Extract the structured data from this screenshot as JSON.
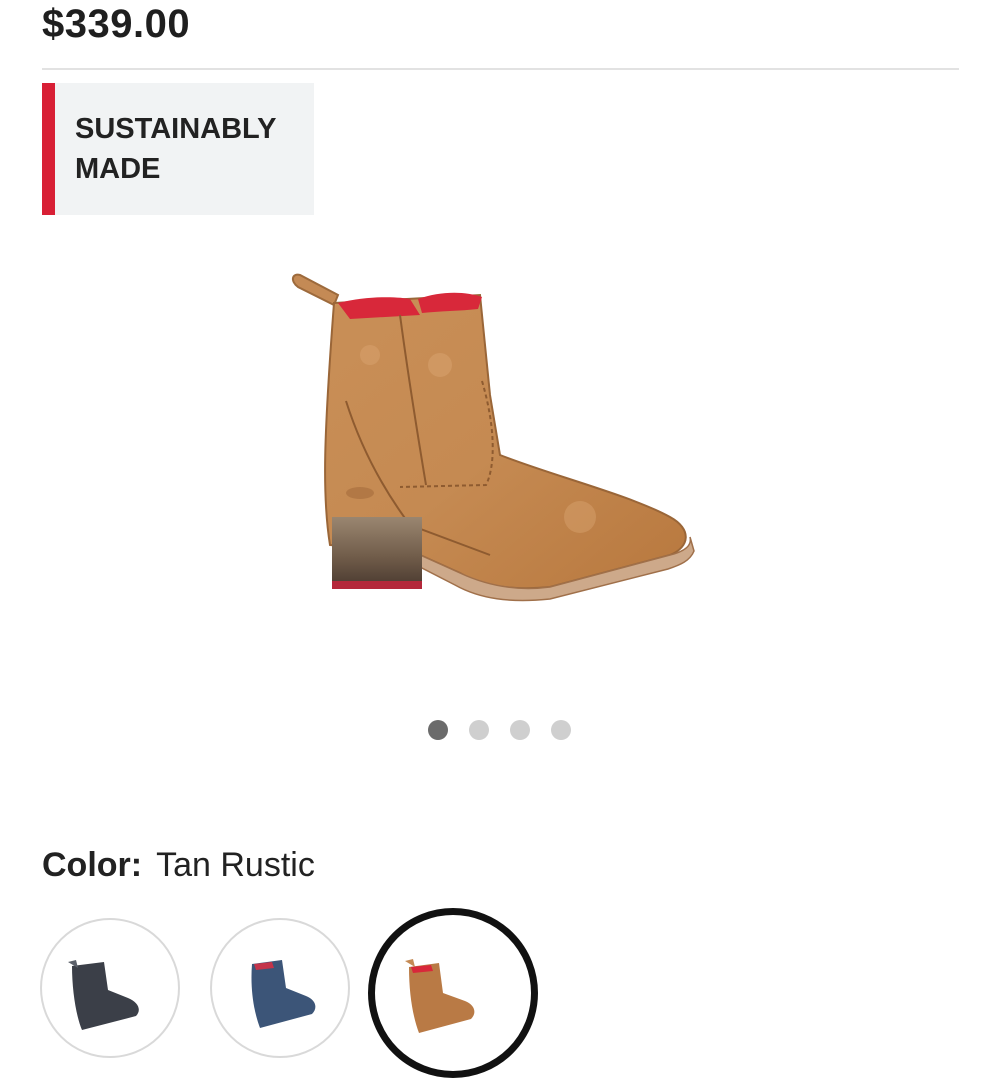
{
  "product": {
    "price": "$339.00",
    "badge_line1": "SUSTAINABLY",
    "badge_line2": "MADE",
    "image_alt": "Tan Rustic leather ankle boot",
    "carousel": {
      "total_images": 4,
      "current_index": 1
    }
  },
  "color": {
    "label": "Color:",
    "selected": "Tan Rustic",
    "swatches": [
      {
        "icon": "dark-boot-swatch",
        "tone": "#3b3f48",
        "selected": false
      },
      {
        "icon": "blue-boot-swatch",
        "tone": "#3c5578",
        "selected": false
      },
      {
        "icon": "tan-boot-swatch",
        "tone": "#b97a45",
        "selected": true
      }
    ]
  },
  "colors": {
    "accent_red": "#d81f35",
    "badge_bg": "#f1f3f4",
    "divider": "#e2e2e2",
    "dot_active": "#6b6b6b",
    "dot_inactive": "#cfcfcf",
    "boot_tan": "#c58a52",
    "boot_lining": "#d8283a"
  }
}
